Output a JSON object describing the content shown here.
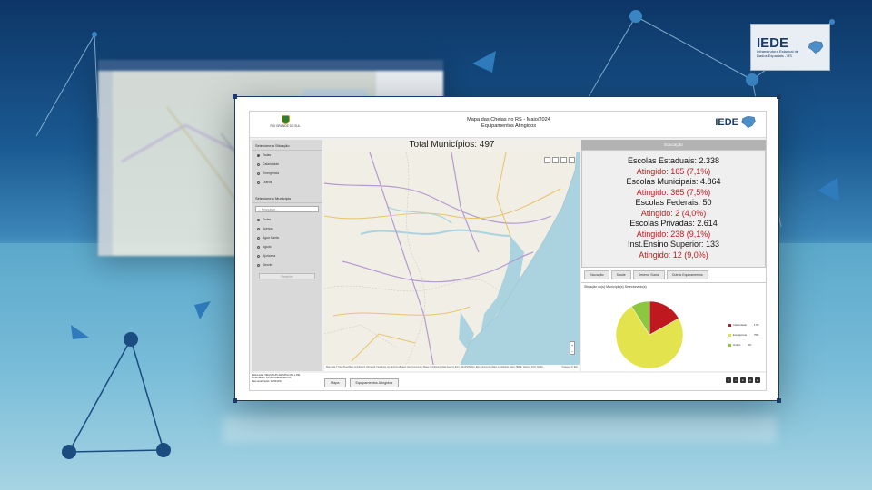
{
  "brand": {
    "logo_text": "IEDE",
    "logo_subtitle": "Infraestrutura Estadual de Dados Espaciais - RS"
  },
  "header": {
    "state_name": "RIO GRANDE DO SUL",
    "title_line1": "Mapa das Cheias no RS - Maio/2024",
    "title_line2": "Equipamentos Atingidos"
  },
  "left_panel": {
    "situation_heading": "Selecione a Situação",
    "situations": [
      {
        "label": "Todas",
        "selected": true
      },
      {
        "label": "Calamidade",
        "selected": false
      },
      {
        "label": "Emergência",
        "selected": false
      },
      {
        "label": "Outros",
        "selected": false
      }
    ],
    "municipio_heading": "Selecione o Município",
    "search_placeholder": "Pesquisar...",
    "municipios": [
      {
        "label": "Todas",
        "selected": true
      },
      {
        "label": "Aceguá",
        "selected": false
      },
      {
        "label": "Água Santa",
        "selected": false
      },
      {
        "label": "Agudo",
        "selected": false
      },
      {
        "label": "Ajuricaba",
        "selected": false
      },
      {
        "label": "Alecrim",
        "selected": false
      }
    ],
    "reset_label": "Redefinir"
  },
  "map": {
    "title": "Total Municípios: 497",
    "zoom_in": "+",
    "zoom_out": "−",
    "attribution": "Map data © OpenStreetMap contributors, Microsoft, Facebook, Inc. and its affiliates, Esri Community Maps contributors, Map layer by Esri | IDE-RS/SPGG, Esri Community Maps contributors | Esri, HERE, Garmin, FAO, NOAA",
    "powered_by": "Powered by Esri"
  },
  "right_panel": {
    "header": "Educação",
    "stats": [
      {
        "text": "Escolas Estaduais: 2.338",
        "hit": false
      },
      {
        "text": "Atingido: 165 (7,1%)",
        "hit": true
      },
      {
        "text": "Escolas Municipais: 4.864",
        "hit": false
      },
      {
        "text": "Atingido: 365 (7,5%)",
        "hit": true
      },
      {
        "text": "Escolas Federais: 50",
        "hit": false
      },
      {
        "text": "Atingido: 2 (4,0%)",
        "hit": true
      },
      {
        "text": "Escolas Privadas: 2.614",
        "hit": false
      },
      {
        "text": "Atingido: 238 (9,1%)",
        "hit": true
      },
      {
        "text": "Inst.Ensino Superior: 133",
        "hit": false
      },
      {
        "text": "Atingido: 12 (9,0%)",
        "hit": true
      }
    ],
    "tabs": [
      "Educação",
      "Saúde",
      "Desenv. Social",
      "Outros Equipamentos"
    ],
    "pie_title": "Situação do(s) Município(s) Selecionado(s)"
  },
  "chart_data": {
    "type": "pie",
    "title": "Situação do(s) Município(s) Selecionado(s)",
    "categories": [
      "Calamidade",
      "Emergência",
      "Outros"
    ],
    "values": [
      17,
      75,
      9
    ],
    "value_labels": [
      "17%",
      "75%",
      "9%"
    ],
    "colors": [
      "#c0181f",
      "#e3e34e",
      "#8dc63f"
    ],
    "legend_position": "right"
  },
  "footer": {
    "lines": [
      "Elaboração: DEGG/SUPLAN/SPGG-RS e IDE",
      "Fonte dados: DPGN/CREDE/SECOM",
      "Data atualização: 01/06/2024"
    ],
    "buttons": [
      "Mapa",
      "Equipamentos Atingidos"
    ],
    "social": [
      "f",
      "x",
      "in",
      "yt",
      "ig"
    ]
  }
}
